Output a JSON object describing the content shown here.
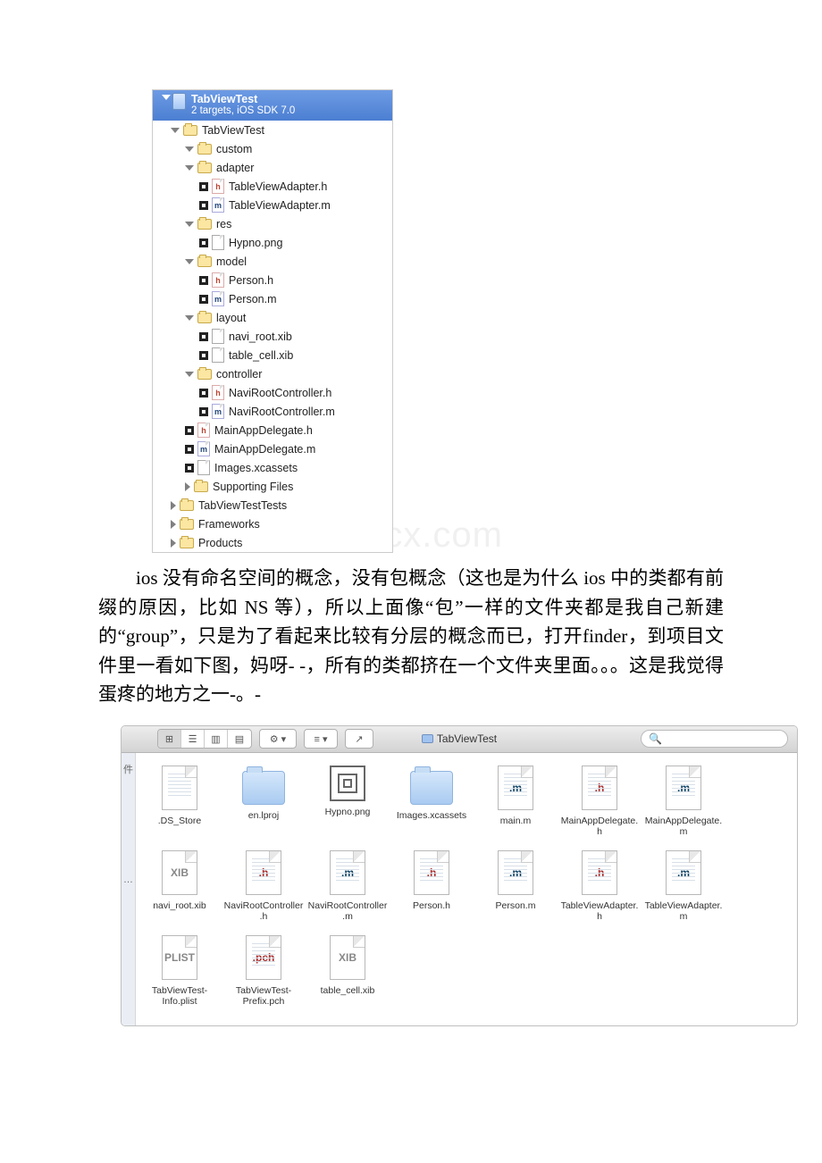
{
  "xcode": {
    "project_name": "TabViewTest",
    "project_sub": "2 targets, iOS SDK 7.0",
    "tree": [
      {
        "indent": 1,
        "type": "folder",
        "disc": "open",
        "label": "TabViewTest"
      },
      {
        "indent": 2,
        "type": "folder",
        "disc": "open",
        "label": "custom"
      },
      {
        "indent": 2,
        "type": "folder",
        "disc": "open",
        "label": "adapter"
      },
      {
        "indent": 3,
        "type": "h",
        "disc": "none",
        "label": "TableViewAdapter.h"
      },
      {
        "indent": 3,
        "type": "m",
        "disc": "none",
        "label": "TableViewAdapter.m"
      },
      {
        "indent": 2,
        "type": "folder",
        "disc": "open",
        "label": "res"
      },
      {
        "indent": 3,
        "type": "img",
        "disc": "none",
        "label": "Hypno.png"
      },
      {
        "indent": 2,
        "type": "folder",
        "disc": "open",
        "label": "model"
      },
      {
        "indent": 3,
        "type": "h",
        "disc": "none",
        "label": "Person.h"
      },
      {
        "indent": 3,
        "type": "m",
        "disc": "none",
        "label": "Person.m"
      },
      {
        "indent": 2,
        "type": "folder",
        "disc": "open",
        "label": "layout"
      },
      {
        "indent": 3,
        "type": "xib",
        "disc": "none",
        "label": "navi_root.xib"
      },
      {
        "indent": 3,
        "type": "xib",
        "disc": "none",
        "label": "table_cell.xib"
      },
      {
        "indent": 2,
        "type": "folder",
        "disc": "open",
        "label": "controller"
      },
      {
        "indent": 3,
        "type": "h",
        "disc": "none",
        "label": "NaviRootController.h"
      },
      {
        "indent": 3,
        "type": "m",
        "disc": "none",
        "label": "NaviRootController.m"
      },
      {
        "indent": 2,
        "type": "h",
        "disc": "none",
        "label": "MainAppDelegate.h"
      },
      {
        "indent": 2,
        "type": "m",
        "disc": "none",
        "label": "MainAppDelegate.m"
      },
      {
        "indent": 2,
        "type": "xca",
        "disc": "none",
        "label": "Images.xcassets"
      },
      {
        "indent": 2,
        "type": "folder",
        "disc": "closed",
        "label": "Supporting Files"
      },
      {
        "indent": 1,
        "type": "folder",
        "disc": "closed",
        "label": "TabViewTestTests"
      },
      {
        "indent": 1,
        "type": "folder",
        "disc": "closed",
        "label": "Frameworks"
      },
      {
        "indent": 1,
        "type": "folder",
        "disc": "closed",
        "label": "Products"
      }
    ]
  },
  "article": {
    "p1": "ios 没有命名空间的概念，没有包概念（这也是为什么 ios 中的类都有前缀的原因，比如 NS 等），所以上面像“包”一样的文件夹都是我自己新建的“group”，只是为了看起来比较有分层的概念而已，打开finder，到项目文件里一看如下图，妈呀- -，所有的类都挤在一个文件夹里面。。。这是我觉得蛋疼的地方之一-。-"
  },
  "finder": {
    "title": "TabViewTest",
    "toolbar": {
      "view_icons": "⊞",
      "view_list": "☰",
      "view_col": "▥",
      "view_cover": "▤",
      "gear": "⚙ ▾",
      "sort": "≡ ▾",
      "share": "↗",
      "search_icon": "🔍"
    },
    "sidebar": {
      "s1": "件",
      "s2": "…"
    },
    "items": [
      {
        "t": "doc",
        "cls": "lines",
        "ext": "",
        "label": ".DS_Store"
      },
      {
        "t": "folder",
        "label": "en.lproj"
      },
      {
        "t": "png",
        "label": "Hypno.png"
      },
      {
        "t": "folder",
        "label": "Images.xcassets"
      },
      {
        "t": "doc",
        "cls": "lines",
        "extcls": "em",
        "ext": ".m",
        "label": "main.m"
      },
      {
        "t": "doc",
        "cls": "lines",
        "extcls": "eh",
        "ext": ".h",
        "label": "MainAppDelegate.h"
      },
      {
        "t": "doc",
        "cls": "lines",
        "extcls": "em",
        "ext": ".m",
        "label": "MainAppDelegate.m"
      },
      {
        "t": "doc",
        "cls": "",
        "extcls": "exib",
        "ext": "XIB",
        "label": "navi_root.xib"
      },
      {
        "t": "doc",
        "cls": "lines",
        "extcls": "eh",
        "ext": ".h",
        "label": "NaviRootController.h"
      },
      {
        "t": "doc",
        "cls": "lines",
        "extcls": "em",
        "ext": ".m",
        "label": "NaviRootController.m"
      },
      {
        "t": "doc",
        "cls": "lines",
        "extcls": "eh",
        "ext": ".h",
        "label": "Person.h"
      },
      {
        "t": "doc",
        "cls": "lines",
        "extcls": "em",
        "ext": ".m",
        "label": "Person.m"
      },
      {
        "t": "doc",
        "cls": "lines",
        "extcls": "eh",
        "ext": ".h",
        "label": "TableViewAdapter.h"
      },
      {
        "t": "doc",
        "cls": "lines",
        "extcls": "em",
        "ext": ".m",
        "label": "TableViewAdapter.m"
      },
      {
        "t": "doc",
        "cls": "",
        "extcls": "eplist",
        "ext": "PLIST",
        "label": "TabViewTest-Info.plist"
      },
      {
        "t": "doc",
        "cls": "lines",
        "extcls": "epch",
        "ext": ".pch",
        "label": "TabViewTest-Prefix.pch"
      },
      {
        "t": "doc",
        "cls": "",
        "extcls": "exib",
        "ext": "XIB",
        "label": "table_cell.xib"
      }
    ]
  }
}
